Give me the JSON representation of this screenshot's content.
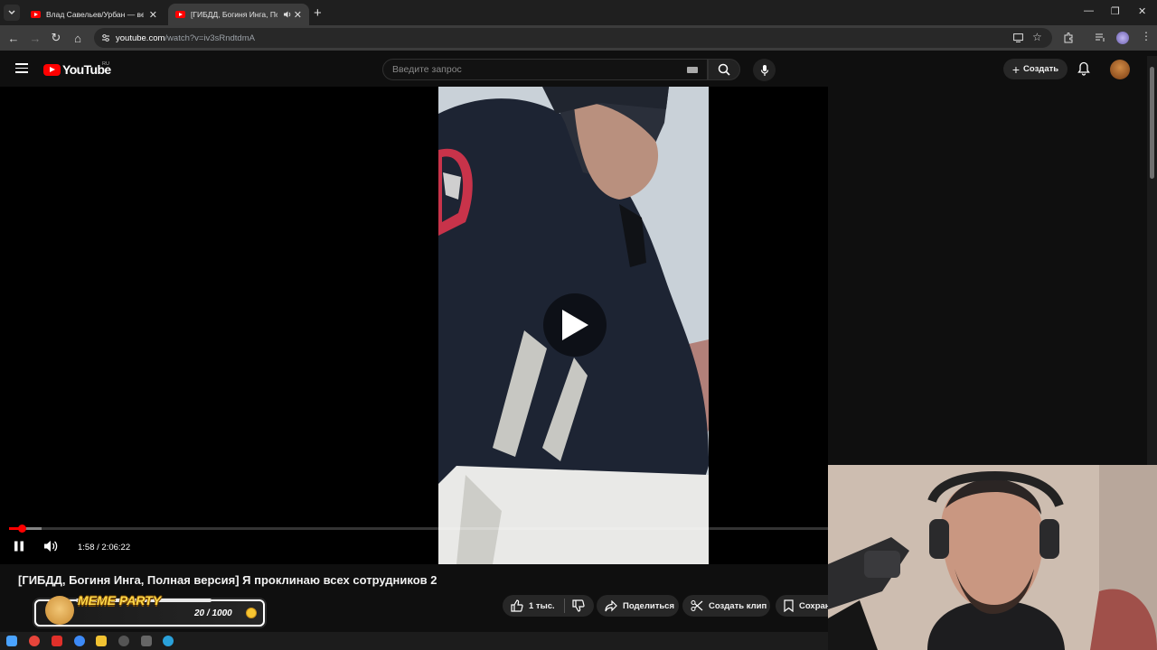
{
  "browser": {
    "tabs": [
      {
        "title": "Влад Савельев/Урбан — весь",
        "active": false
      },
      {
        "title": "[ГИБДД, Богиня Инга, Пол",
        "active": true
      }
    ],
    "url_host": "youtube.com",
    "url_path": "/watch?v=iv3sRndtdmA"
  },
  "youtube": {
    "logo_text": "YouTube",
    "region": "RU",
    "search_placeholder": "Введите запрос",
    "create_label": "Создать"
  },
  "player": {
    "current_time": "1:58",
    "duration": "2:06:22",
    "time_display": "1:58 / 2:06:22",
    "progress_fraction": 0.0156,
    "buffered_fraction": 0.04,
    "state": "playing"
  },
  "video": {
    "title": "[ГИБДД, Богиня Инга, Полная версия] Я проклинаю всех сотрудников 2",
    "like_count": "1 тыс.",
    "share_label": "Поделиться",
    "clip_label": "Создать клип",
    "save_label": "Сохран"
  },
  "overlay": {
    "meme_party_title": "MEME PARTY",
    "meme_party_count": "20 / 1000"
  },
  "colors": {
    "accent": "#ff0000",
    "background": "#0f0f0f",
    "chip": "#272727"
  },
  "icons": [
    "chevron-down-icon",
    "youtube-favicon",
    "speaker-icon",
    "close-icon",
    "plus-icon",
    "minimize-icon",
    "restore-icon",
    "back-icon",
    "forward-icon",
    "reload-icon",
    "home-icon",
    "site-info-icon",
    "install-icon",
    "star-icon",
    "extensions-icon",
    "media-icon",
    "profile-icon",
    "kebab-icon",
    "menu-icon",
    "keyboard-icon",
    "search-icon",
    "mic-icon",
    "bell-icon",
    "play-icon",
    "pause-icon",
    "volume-icon",
    "thumb-up-icon",
    "thumb-down-icon",
    "share-icon",
    "scissors-icon",
    "bookmark-icon",
    "coin-icon"
  ]
}
